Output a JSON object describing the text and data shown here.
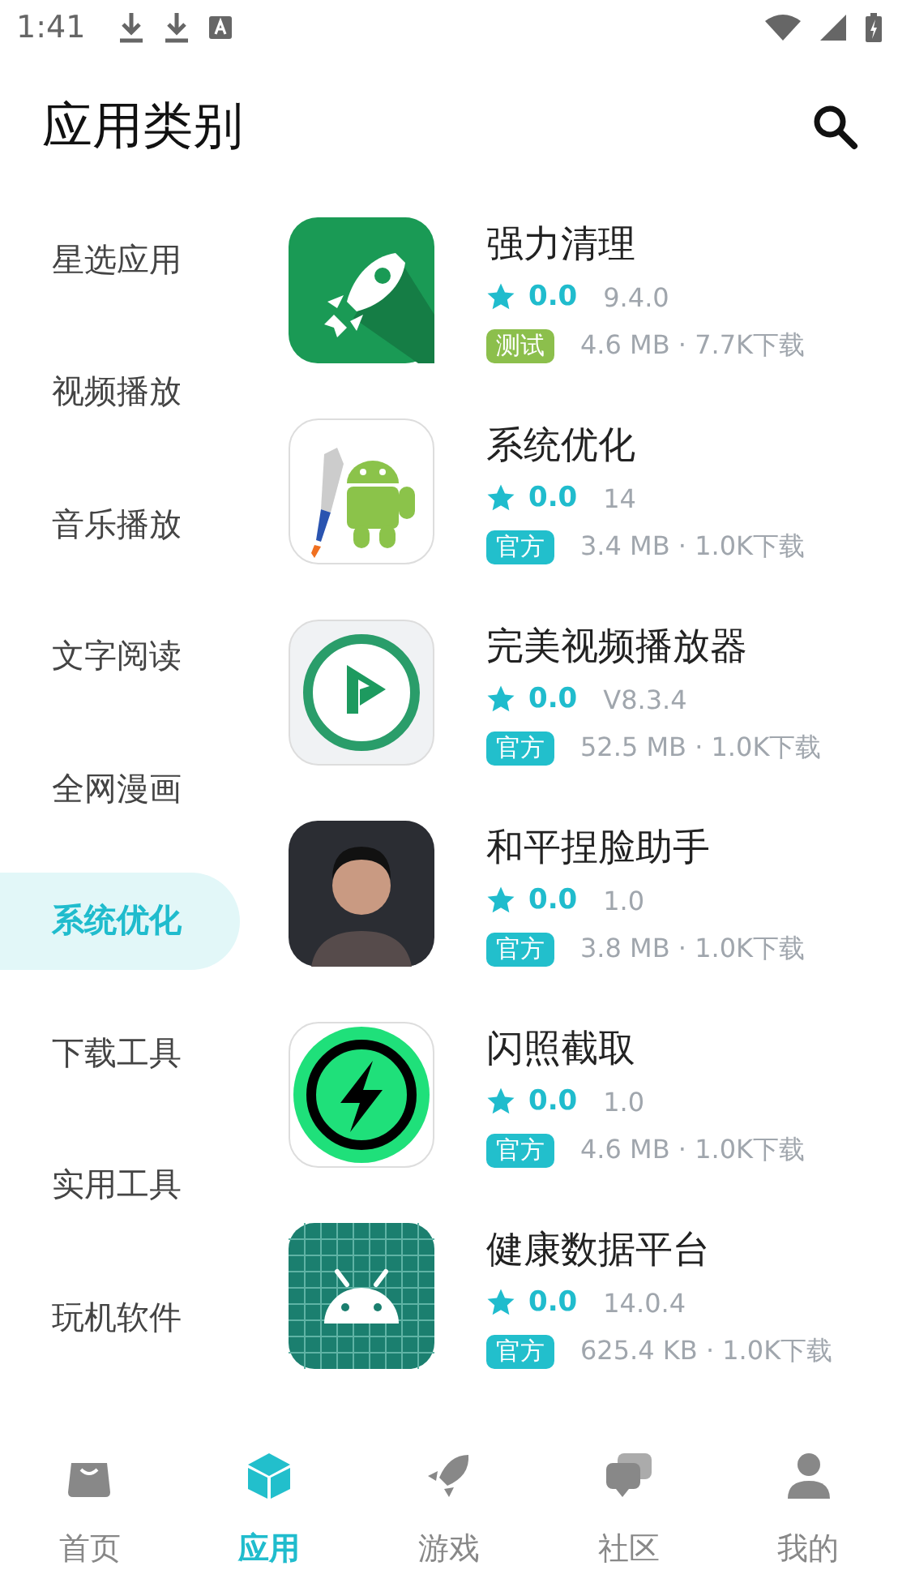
{
  "status_bar": {
    "time": "1:41"
  },
  "header": {
    "title": "应用类别"
  },
  "sidebar": {
    "items": [
      {
        "label": "星选应用",
        "selected": false
      },
      {
        "label": "视频播放",
        "selected": false
      },
      {
        "label": "音乐播放",
        "selected": false
      },
      {
        "label": "文字阅读",
        "selected": false
      },
      {
        "label": "全网漫画",
        "selected": false
      },
      {
        "label": "系统优化",
        "selected": true
      },
      {
        "label": "下载工具",
        "selected": false
      },
      {
        "label": "实用工具",
        "selected": false
      },
      {
        "label": "玩机软件",
        "selected": false
      }
    ]
  },
  "apps": [
    {
      "kind": "rocket",
      "name": "强力清理",
      "rating": "0.0",
      "version": "9.4.0",
      "tag": {
        "kind": "test",
        "label": "测试"
      },
      "meta": "4.6 MB · 7.7K下载"
    },
    {
      "kind": "robot-sword",
      "name": "系统优化",
      "rating": "0.0",
      "version": "14",
      "tag": {
        "kind": "official",
        "label": "官方"
      },
      "meta": "3.4 MB · 1.0K下载"
    },
    {
      "kind": "play",
      "name": "完美视频播放器",
      "rating": "0.0",
      "version": "V8.3.4",
      "tag": {
        "kind": "official",
        "label": "官方"
      },
      "meta": "52.5 MB · 1.0K下载"
    },
    {
      "kind": "person",
      "name": "和平捏脸助手",
      "rating": "0.0",
      "version": "1.0",
      "tag": {
        "kind": "official",
        "label": "官方"
      },
      "meta": "3.8 MB · 1.0K下载"
    },
    {
      "kind": "bolt",
      "name": "闪照截取",
      "rating": "0.0",
      "version": "1.0",
      "tag": {
        "kind": "official",
        "label": "官方"
      },
      "meta": "4.6 MB · 1.0K下载"
    },
    {
      "kind": "robot-grid",
      "name": "健康数据平台",
      "rating": "0.0",
      "version": "14.0.4",
      "tag": {
        "kind": "official",
        "label": "官方"
      },
      "meta": "625.4 KB · 1.0K下载"
    }
  ],
  "bottom_nav": [
    {
      "kind": "bag",
      "label": "首页",
      "selected": false
    },
    {
      "kind": "cube",
      "label": "应用",
      "selected": true
    },
    {
      "kind": "rocket",
      "label": "游戏",
      "selected": false
    },
    {
      "kind": "chat",
      "label": "社区",
      "selected": false
    },
    {
      "kind": "person",
      "label": "我的",
      "selected": false
    }
  ]
}
